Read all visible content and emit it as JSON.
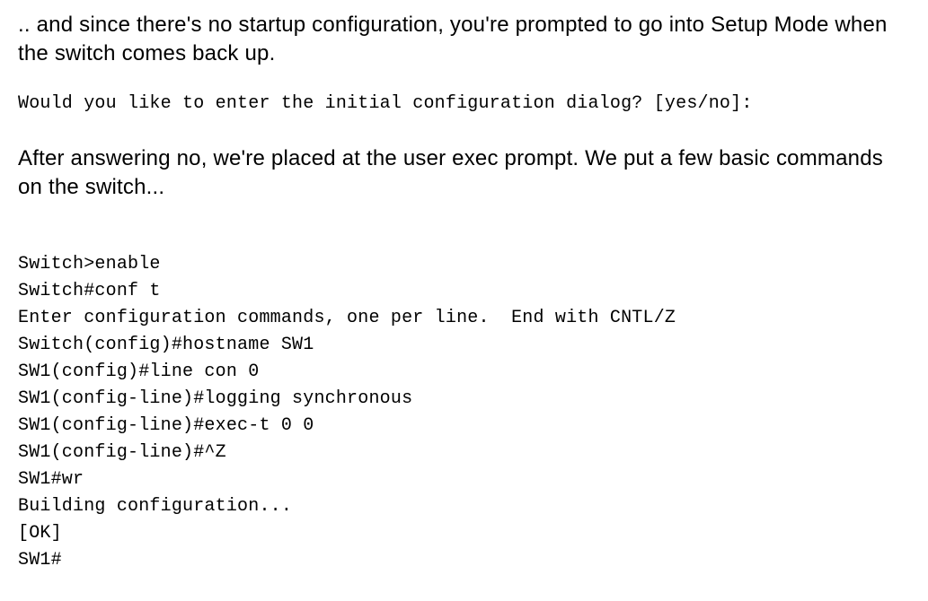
{
  "paragraphs": {
    "intro": ".. and since there's no startup configuration, you're prompted to go into Setup Mode when the switch comes back up.",
    "after_no": "After answering no, we're placed at the user exec prompt. We put a few basic commands on the switch..."
  },
  "prompts": {
    "initial_dialog": "Would you like to enter the initial configuration dialog? [yes/no]:"
  },
  "terminal": {
    "lines": [
      "Switch>enable",
      "Switch#conf t",
      "Enter configuration commands, one per line.  End with CNTL/Z",
      "Switch(config)#hostname SW1",
      "SW1(config)#line con 0",
      "SW1(config-line)#logging synchronous",
      "SW1(config-line)#exec-t 0 0",
      "SW1(config-line)#^Z",
      "SW1#wr",
      "Building configuration...",
      "[OK]",
      "SW1#"
    ]
  }
}
